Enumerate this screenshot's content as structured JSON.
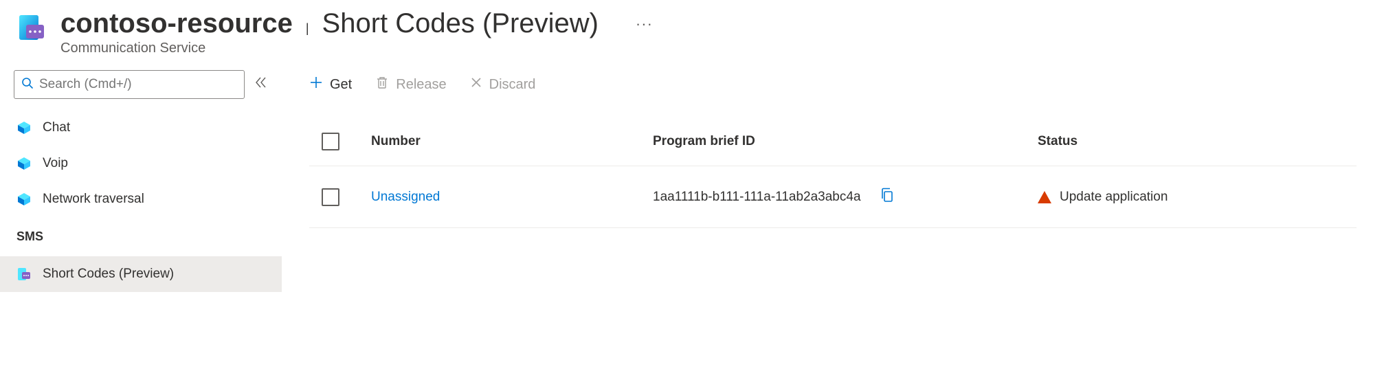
{
  "header": {
    "resource_name": "contoso-resource",
    "page_title": "Short Codes (Preview)",
    "subtitle": "Communication Service",
    "ellipsis": "···"
  },
  "sidebar": {
    "search_placeholder": "Search (Cmd+/)",
    "items": [
      {
        "label": "Chat",
        "icon": "cube"
      },
      {
        "label": "Voip",
        "icon": "cube"
      },
      {
        "label": "Network traversal",
        "icon": "cube"
      }
    ],
    "section_header": "SMS",
    "sms_items": [
      {
        "label": "Short Codes (Preview)",
        "icon": "shortcode",
        "selected": true
      }
    ]
  },
  "toolbar": {
    "get_label": "Get",
    "release_label": "Release",
    "discard_label": "Discard"
  },
  "table": {
    "columns": {
      "number": "Number",
      "program_brief_id": "Program brief ID",
      "status": "Status"
    },
    "rows": [
      {
        "number": "Unassigned",
        "program_brief_id": "1aa1111b-b111-111a-11ab2a3abc4a",
        "status": "Update application"
      }
    ]
  }
}
